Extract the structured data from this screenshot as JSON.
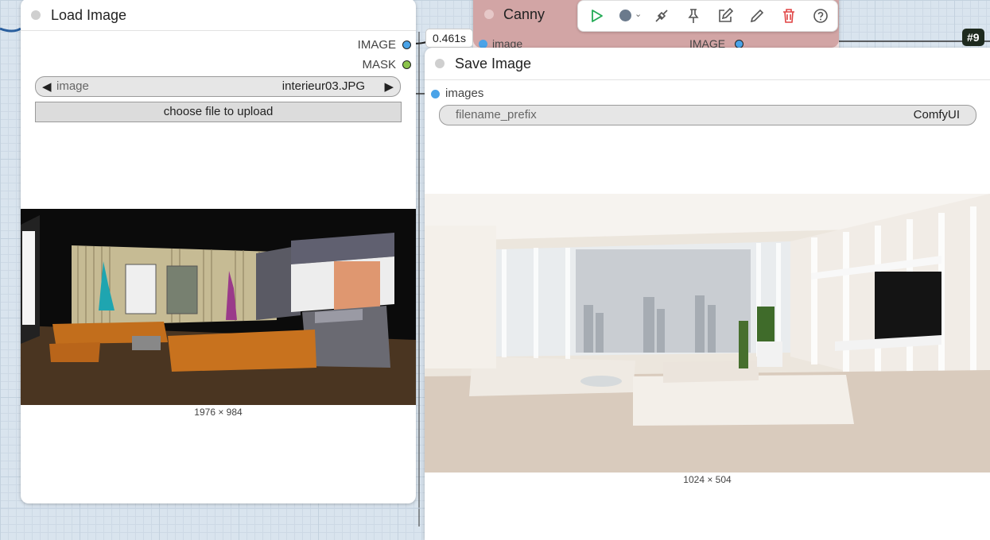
{
  "load_image_node": {
    "title": "Load Image",
    "outputs": [
      "IMAGE",
      "MASK"
    ],
    "image_selector": {
      "label": "image",
      "value": "interieur03.JPG",
      "prev_icon": "◀",
      "next_icon": "▶"
    },
    "upload_button": "choose file to upload",
    "preview_size": "1976 × 984"
  },
  "canny_node": {
    "title": "Canny",
    "input_label": "image",
    "output_label": "IMAGE",
    "exec_time": "0.461s",
    "header_color": "#d2a5a5"
  },
  "save_image_node": {
    "title": "Save Image",
    "input_label": "images",
    "filename_prefix": {
      "label": "filename_prefix",
      "value": "ComfyUI"
    },
    "preview_size": "1024 × 504"
  },
  "node_badge": "#9",
  "toolbar": {
    "icons": [
      "run-icon",
      "color-picker-icon",
      "bypass-icon",
      "pin-icon",
      "edit-icon",
      "pencil-icon",
      "delete-icon",
      "help-icon"
    ]
  },
  "colors": {
    "image_slot": "#4aa3e8",
    "mask_slot": "#8bc34a",
    "delete": "#e04444",
    "run": "#22aa55"
  }
}
